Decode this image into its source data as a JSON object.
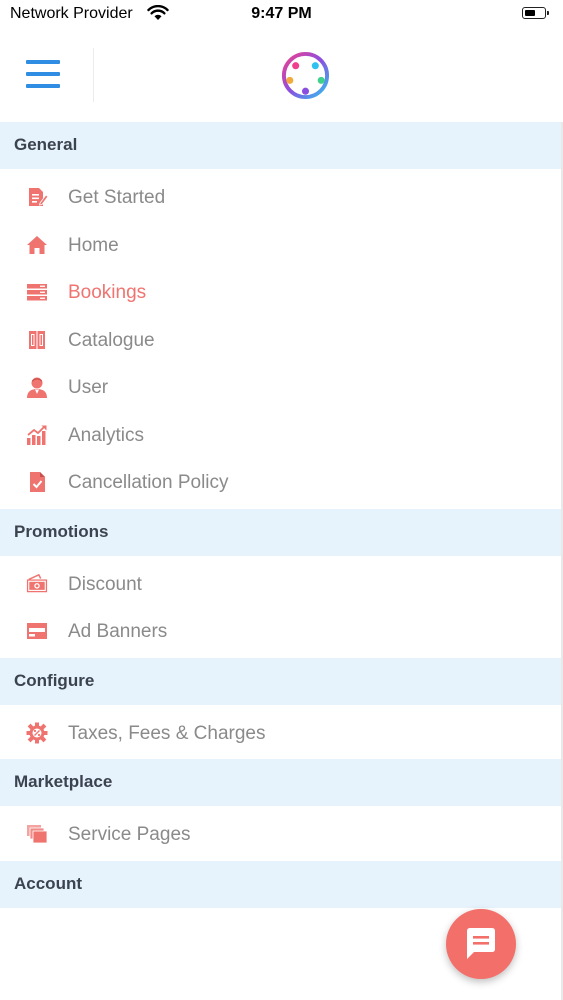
{
  "status_bar": {
    "carrier": "Network Provider",
    "time": "9:47 PM",
    "battery_level": 0.6
  },
  "header": {
    "menu_icon": "hamburger-icon",
    "logo": "people-circle-logo"
  },
  "colors": {
    "section_bg": "#e6f3fc",
    "accent": "#ef7470",
    "menu_icon_blue": "#2f8de4",
    "fab": "#f26f6a"
  },
  "sections": [
    {
      "title": "General",
      "items": [
        {
          "label": "Get Started",
          "icon": "edit-document-icon"
        },
        {
          "label": "Home",
          "icon": "home-icon"
        },
        {
          "label": "Bookings",
          "icon": "list-icon",
          "active": true
        },
        {
          "label": "Catalogue",
          "icon": "book-icon"
        },
        {
          "label": "User",
          "icon": "user-icon"
        },
        {
          "label": "Analytics",
          "icon": "bar-chart-icon"
        },
        {
          "label": "Cancellation Policy",
          "icon": "file-check-icon"
        }
      ]
    },
    {
      "title": "Promotions",
      "items": [
        {
          "label": "Discount",
          "icon": "money-icon"
        },
        {
          "label": "Ad Banners",
          "icon": "banner-icon"
        }
      ]
    },
    {
      "title": "Configure",
      "items": [
        {
          "label": "Taxes, Fees & Charges",
          "icon": "gear-percent-icon"
        }
      ]
    },
    {
      "title": "Marketplace",
      "items": [
        {
          "label": "Service Pages",
          "icon": "pages-icon"
        }
      ]
    },
    {
      "title": "Account",
      "items": []
    }
  ],
  "fab": {
    "icon": "chat-icon"
  }
}
